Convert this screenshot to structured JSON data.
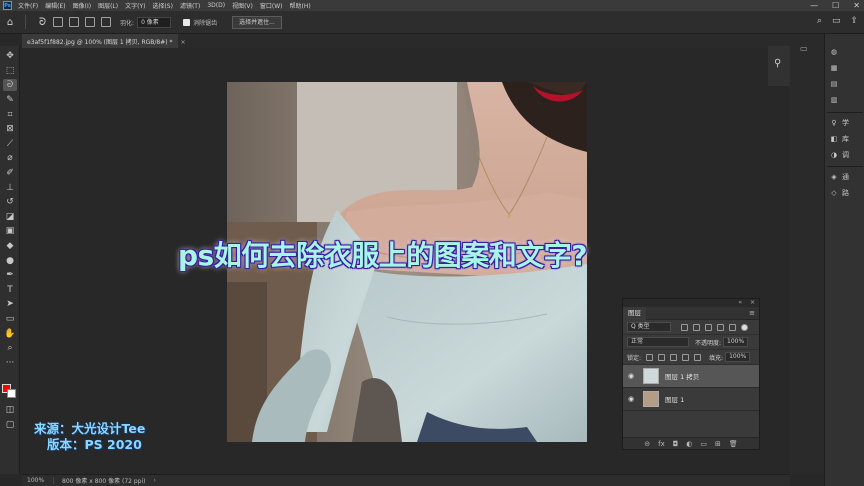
{
  "app": {
    "logo": "Ps"
  },
  "menu": [
    "文件(F)",
    "编辑(E)",
    "图像(I)",
    "图层(L)",
    "文字(Y)",
    "选择(S)",
    "滤镜(T)",
    "3D(D)",
    "视图(V)",
    "窗口(W)",
    "帮助(H)"
  ],
  "window_controls": {
    "minimize": "—",
    "maximize": "☐",
    "close": "✕"
  },
  "options": {
    "feather_label": "羽化:",
    "feather_value": "0 像素",
    "antialias_label": "消除锯齿",
    "select_mask_button": "选择并遮住..."
  },
  "document": {
    "tab_title": "e3af5f1f882.jpg @ 100% (图层 1 拷贝, RGB/8#) *",
    "tab_close": "×"
  },
  "overlay": {
    "title": "ps如何去除衣服上的图案和文字?",
    "source_line1": "来源：大光设计Tee",
    "source_line2": "版本：PS 2020"
  },
  "status": {
    "zoom": "100%",
    "info": "800 像素 x 800 像素 (72 ppi)",
    "arrow": "›"
  },
  "right_panels": [
    {
      "icon": "color-wheel-icon",
      "glyph": "◍",
      "label": ""
    },
    {
      "icon": "swatches-icon",
      "glyph": "▦",
      "label": ""
    },
    {
      "icon": "gradient-icon",
      "glyph": "▤",
      "label": ""
    },
    {
      "icon": "patterns-icon",
      "glyph": "▥",
      "label": ""
    },
    {
      "icon": "learn-icon",
      "glyph": "♀",
      "label": "学"
    },
    {
      "icon": "libraries-icon",
      "glyph": "◧",
      "label": "库"
    },
    {
      "icon": "adjustments-icon",
      "glyph": "◑",
      "label": "调"
    },
    {
      "icon": "channels-icon",
      "glyph": "◈",
      "label": "通"
    },
    {
      "icon": "paths-icon",
      "glyph": "◇",
      "label": "路"
    }
  ],
  "layers_panel": {
    "collapse": "«",
    "close": "×",
    "tab_label": "图层",
    "menu_glyph": "≡",
    "filter_label": "Q 类型",
    "blend_mode": "正常",
    "opacity_label": "不透明度:",
    "opacity_value": "100%",
    "lock_label": "锁定:",
    "fill_label": "填充:",
    "fill_value": "100%",
    "layers": [
      {
        "name": "图层 1 拷贝",
        "visible": true,
        "selected": true
      },
      {
        "name": "图层 1",
        "visible": true,
        "selected": false
      }
    ],
    "footer_glyphs": [
      "⊝",
      "fx",
      "◘",
      "◐",
      "▭",
      "⊞",
      "🗑"
    ]
  }
}
